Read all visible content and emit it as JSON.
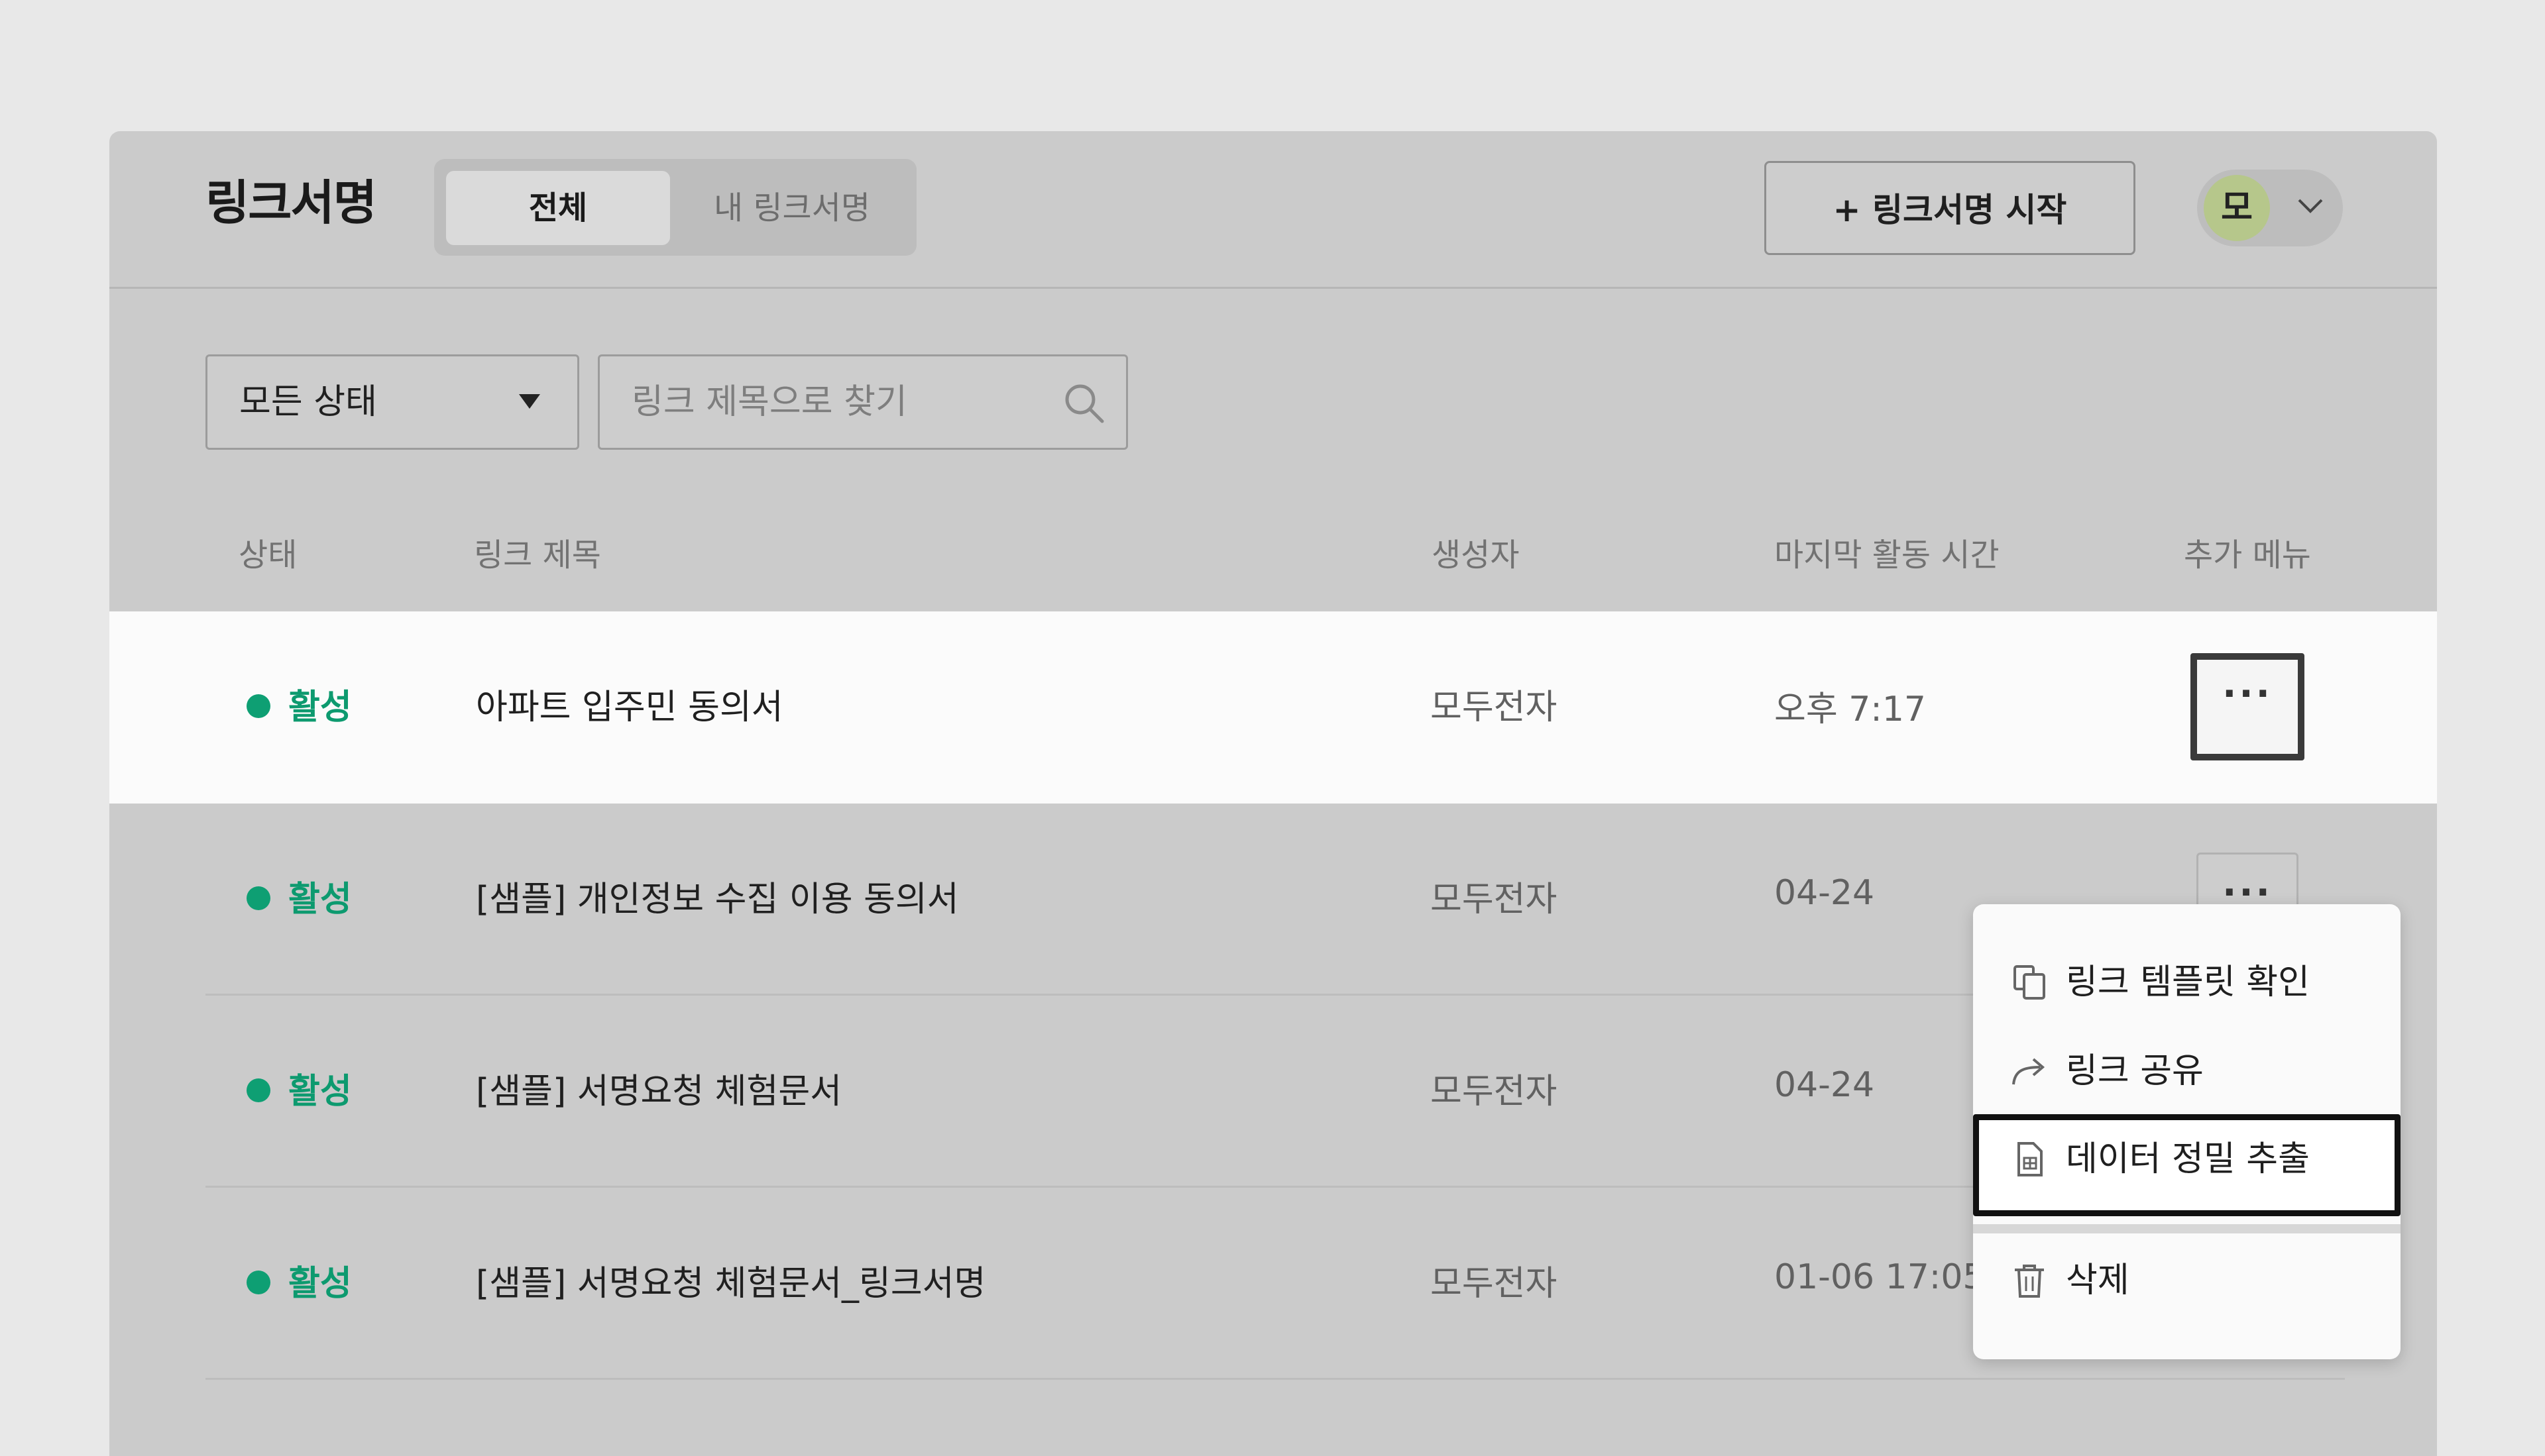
{
  "header": {
    "app_title": "링크서명",
    "tabs": [
      {
        "label": "전체",
        "active": true
      },
      {
        "label": "내 링크서명",
        "active": false
      }
    ],
    "start_button": "+ 링크서명 시작",
    "avatar_initial": "모"
  },
  "filters": {
    "status_value": "모든 상태",
    "search_placeholder": "링크 제목으로 찾기"
  },
  "table": {
    "columns": [
      "상태",
      "링크 제목",
      "생성자",
      "마지막 활동 시간",
      "추가 메뉴"
    ],
    "rows": [
      {
        "status": "활성",
        "title": "아파트 입주민 동의서",
        "creator": "모두전자",
        "last_activity": "오후 7:17"
      },
      {
        "status": "활성",
        "title": "[샘플] 개인정보 수집 이용 동의서",
        "creator": "모두전자",
        "last_activity": "04-24"
      },
      {
        "status": "활성",
        "title": "[샘플] 서명요청 체험문서",
        "creator": "모두전자",
        "last_activity": "04-24"
      },
      {
        "status": "활성",
        "title": "[샘플] 서명요청 체험문서_링크서명",
        "creator": "모두전자",
        "last_activity": "01-06 17:05"
      }
    ],
    "more_label": "···"
  },
  "context_menu": {
    "items": [
      {
        "label": "링크 템플릿 확인",
        "icon": "copy-icon"
      },
      {
        "label": "링크 공유",
        "icon": "share-icon"
      },
      {
        "label": "데이터 정밀 추출",
        "icon": "document-icon",
        "focused": true
      },
      {
        "label": "삭제",
        "icon": "trash-icon"
      }
    ]
  },
  "colors": {
    "active_status": "#0d9a6f",
    "overlay": "#cbcbcb",
    "avatar_bg": "#b6c78b"
  }
}
